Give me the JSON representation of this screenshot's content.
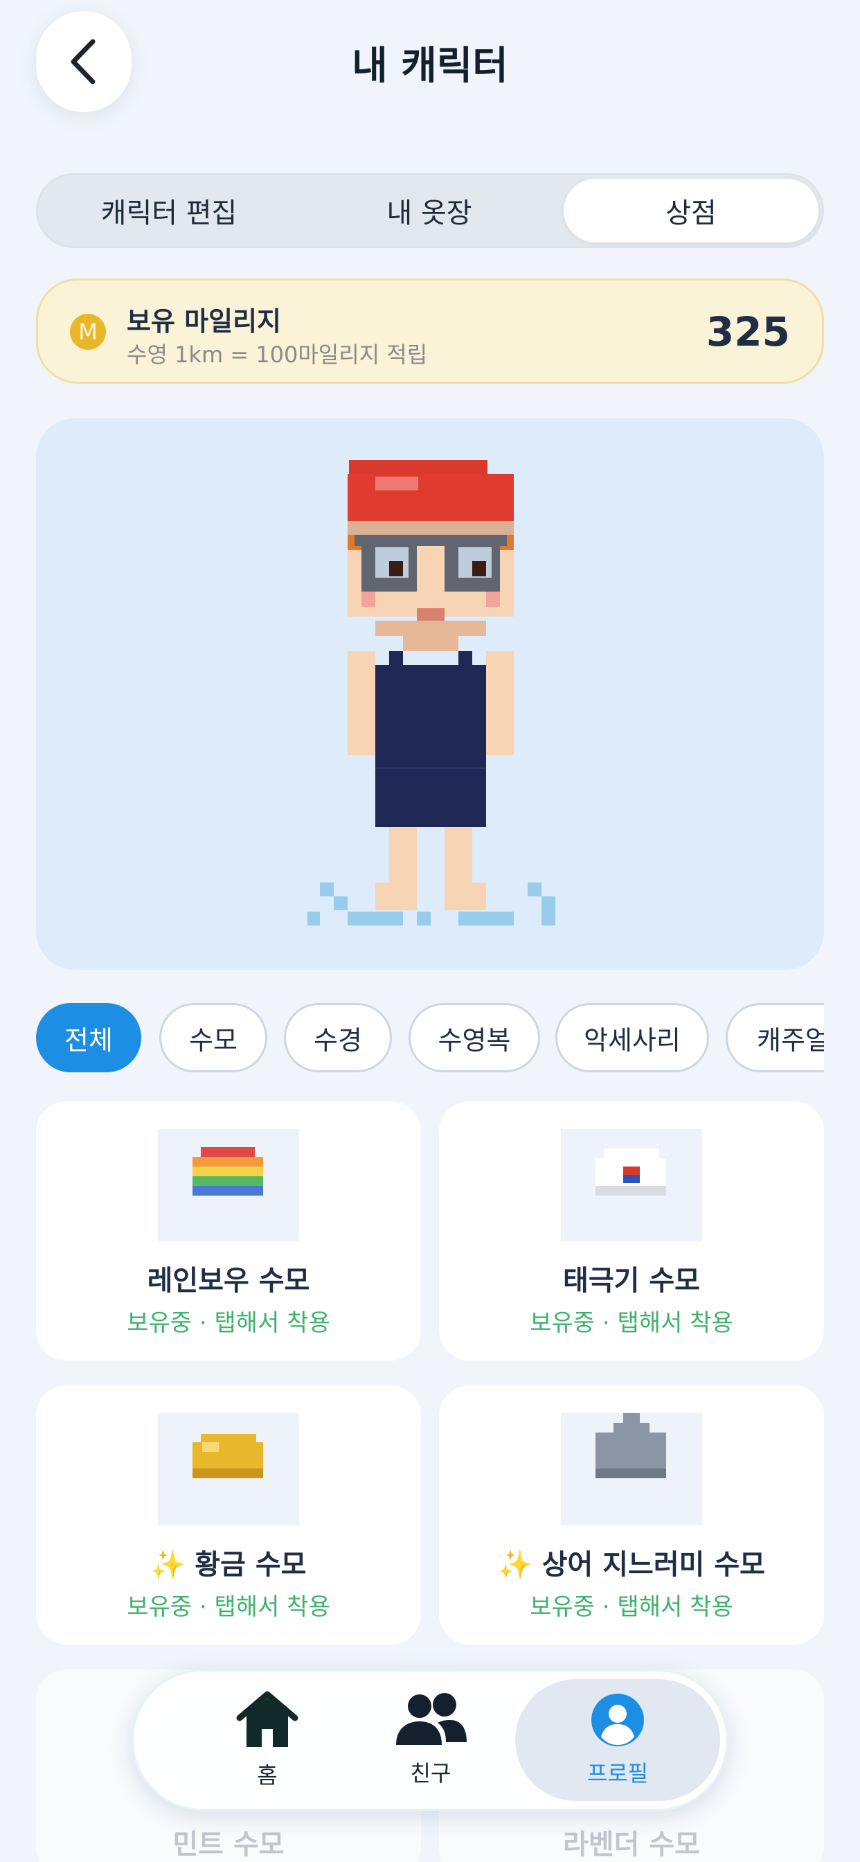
{
  "header": {
    "title": "내 캐릭터",
    "back_icon": "chevron-left-icon"
  },
  "segments": [
    {
      "label": "캐릭터 편집",
      "active": false
    },
    {
      "label": "내 옷장",
      "active": false
    },
    {
      "label": "상점",
      "active": true
    }
  ],
  "mileage": {
    "coin_letter": "M",
    "title": "보유 마일리지",
    "subtitle": "수영 1km = 100마일리지 적립",
    "value": "325"
  },
  "filters": [
    {
      "label": "전체",
      "active": true
    },
    {
      "label": "수모",
      "active": false
    },
    {
      "label": "수경",
      "active": false
    },
    {
      "label": "수영복",
      "active": false
    },
    {
      "label": "악세사리",
      "active": false
    },
    {
      "label": "캐주얼",
      "active": false
    }
  ],
  "items": [
    {
      "name": "레인보우 수모",
      "status": "보유중 · 탭해서 착용",
      "icon": "rainbow-cap-icon"
    },
    {
      "name": "태극기 수모",
      "status": "보유중 · 탭해서 착용",
      "icon": "taegukgi-cap-icon"
    },
    {
      "name": "✨ 황금 수모",
      "status": "보유중 · 탭해서 착용",
      "icon": "gold-cap-icon"
    },
    {
      "name": "✨ 상어 지느러미 수모",
      "status": "보유중 · 탭해서 착용",
      "icon": "shark-fin-cap-icon"
    },
    {
      "name": "민트 수모"
    },
    {
      "name": "라벤더 수모"
    }
  ],
  "tabbar": {
    "home": {
      "label": "홈",
      "icon": "home-icon"
    },
    "friends": {
      "label": "친구",
      "icon": "friends-icon"
    },
    "profile": {
      "label": "프로필",
      "icon": "profile-icon",
      "active": true
    }
  },
  "colors": {
    "accent": "#1C8EE3",
    "owned_text": "#3DB26A",
    "mileage_bg": "#FBF3D8",
    "coin": "#E8B72A"
  }
}
